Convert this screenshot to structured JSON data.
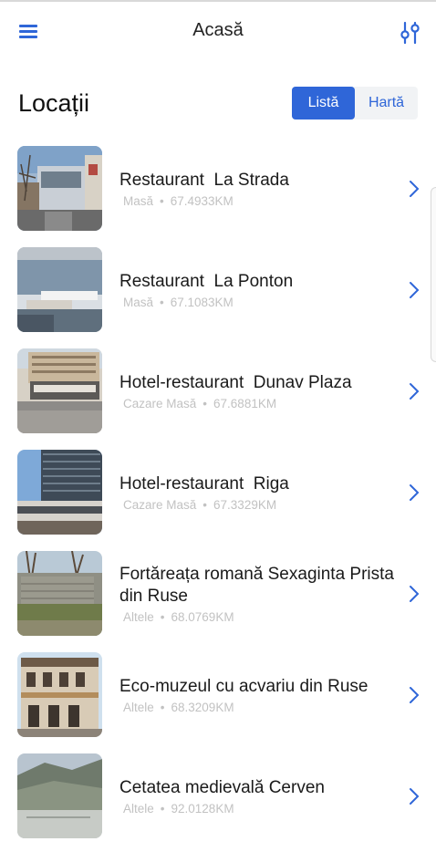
{
  "appbar": {
    "title": "Acasă",
    "menu_icon": "menu-icon",
    "filter_icon": "sliders-icon"
  },
  "page": {
    "title": "Locații"
  },
  "view_toggle": {
    "list_label": "Listă",
    "map_label": "Hartă",
    "selected": "Listă"
  },
  "colors": {
    "accent": "#2f66d8",
    "meta_text": "#c2c2c2"
  },
  "locations": [
    {
      "name": "Restaurant  La Strada",
      "category": "Masă",
      "distance": "67.4933KM"
    },
    {
      "name": "Restaurant  La Ponton",
      "category": "Masă",
      "distance": "67.1083KM"
    },
    {
      "name": "Hotel-restaurant  Dunav Plaza",
      "category": "Cazare Masă",
      "distance": "67.6881KM"
    },
    {
      "name": "Hotel-restaurant  Riga",
      "category": "Cazare Masă",
      "distance": "67.3329KM"
    },
    {
      "name": "Fortăreața romană Sexaginta Prista din Ruse",
      "category": "Altele",
      "distance": "68.0769KM"
    },
    {
      "name": "Eco-muzeul cu acvariu din Ruse",
      "category": "Altele",
      "distance": "68.3209KM"
    },
    {
      "name": "Cetatea medievală Cerven",
      "category": "Altele",
      "distance": "92.0128KM"
    }
  ]
}
